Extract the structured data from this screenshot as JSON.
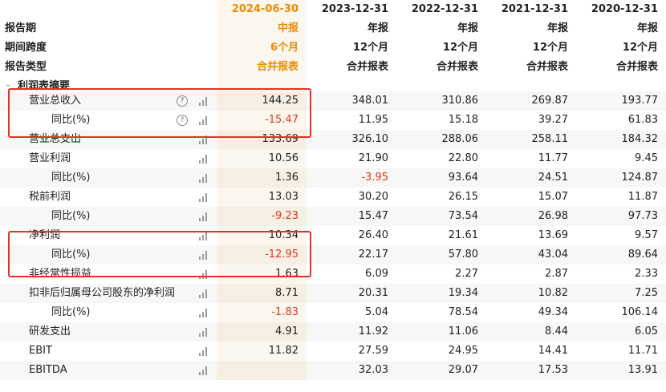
{
  "header": {
    "columns": [
      "2024-06-30",
      "2023-12-31",
      "2022-12-31",
      "2021-12-31",
      "2020-12-31"
    ],
    "rows": [
      {
        "label": "报告期",
        "values": [
          "中报",
          "年报",
          "年报",
          "年报",
          "年报"
        ]
      },
      {
        "label": "期间跨度",
        "values": [
          "6个月",
          "12个月",
          "12个月",
          "12个月",
          "12个月"
        ]
      },
      {
        "label": "报告类型",
        "values": [
          "合并报表",
          "合并报表",
          "合并报表",
          "合并报表",
          "合并报表"
        ]
      }
    ]
  },
  "section_title": "利润表摘要",
  "rows": [
    {
      "label": "营业总收入",
      "indent": 1,
      "help": true,
      "values": [
        "144.25",
        "348.01",
        "310.86",
        "269.87",
        "193.77"
      ],
      "neg": [
        false,
        false,
        false,
        false,
        false
      ]
    },
    {
      "label": "同比(%)",
      "indent": 2,
      "help": true,
      "values": [
        "-15.47",
        "11.95",
        "15.18",
        "39.27",
        "61.83"
      ],
      "neg": [
        true,
        false,
        false,
        false,
        false
      ]
    },
    {
      "label": "营业总支出",
      "indent": 1,
      "help": false,
      "values": [
        "133.69",
        "326.10",
        "288.06",
        "258.11",
        "184.32"
      ],
      "neg": [
        false,
        false,
        false,
        false,
        false
      ]
    },
    {
      "label": "营业利润",
      "indent": 1,
      "help": false,
      "values": [
        "10.56",
        "21.90",
        "22.80",
        "11.77",
        "9.45"
      ],
      "neg": [
        false,
        false,
        false,
        false,
        false
      ]
    },
    {
      "label": "同比(%)",
      "indent": 2,
      "help": false,
      "values": [
        "1.36",
        "-3.95",
        "93.64",
        "24.51",
        "124.87"
      ],
      "neg": [
        false,
        true,
        false,
        false,
        false
      ]
    },
    {
      "label": "税前利润",
      "indent": 1,
      "help": false,
      "values": [
        "13.03",
        "30.20",
        "26.15",
        "15.07",
        "11.87"
      ],
      "neg": [
        false,
        false,
        false,
        false,
        false
      ]
    },
    {
      "label": "同比(%)",
      "indent": 2,
      "help": false,
      "values": [
        "-9.23",
        "15.47",
        "73.54",
        "26.98",
        "97.73"
      ],
      "neg": [
        true,
        false,
        false,
        false,
        false
      ]
    },
    {
      "label": "净利润",
      "indent": 1,
      "help": false,
      "values": [
        "10.34",
        "26.40",
        "21.61",
        "13.69",
        "9.57"
      ],
      "neg": [
        false,
        false,
        false,
        false,
        false
      ]
    },
    {
      "label": "同比(%)",
      "indent": 2,
      "help": false,
      "values": [
        "-12.95",
        "22.17",
        "57.80",
        "43.04",
        "89.64"
      ],
      "neg": [
        true,
        false,
        false,
        false,
        false
      ]
    },
    {
      "label": "非经常性损益",
      "indent": 1,
      "help": false,
      "values": [
        "1.63",
        "6.09",
        "2.27",
        "2.87",
        "2.33"
      ],
      "neg": [
        false,
        false,
        false,
        false,
        false
      ]
    },
    {
      "label": "扣非后归属母公司股东的净利润",
      "indent": 1,
      "help": false,
      "values": [
        "8.71",
        "20.31",
        "19.34",
        "10.82",
        "7.25"
      ],
      "neg": [
        false,
        false,
        false,
        false,
        false
      ]
    },
    {
      "label": "同比(%)",
      "indent": 2,
      "help": false,
      "values": [
        "-1.83",
        "5.04",
        "78.54",
        "49.34",
        "106.14"
      ],
      "neg": [
        true,
        false,
        false,
        false,
        false
      ]
    },
    {
      "label": "研发支出",
      "indent": 1,
      "help": false,
      "values": [
        "4.91",
        "11.92",
        "11.06",
        "8.44",
        "6.05"
      ],
      "neg": [
        false,
        false,
        false,
        false,
        false
      ]
    },
    {
      "label": "EBIT",
      "indent": 1,
      "help": false,
      "values": [
        "11.82",
        "27.59",
        "24.95",
        "14.41",
        "11.71"
      ],
      "neg": [
        false,
        false,
        false,
        false,
        false
      ]
    },
    {
      "label": "EBITDA",
      "indent": 1,
      "help": false,
      "values": [
        "",
        "32.03",
        "29.07",
        "17.53",
        "13.91"
      ],
      "neg": [
        false,
        false,
        false,
        false,
        false
      ]
    }
  ],
  "icons": {
    "help": "question-circle-icon",
    "chart": "bar-chart-icon"
  },
  "colors": {
    "accent": "#f08a00",
    "negative": "#e8331e",
    "highlight_box": "#e53124"
  }
}
